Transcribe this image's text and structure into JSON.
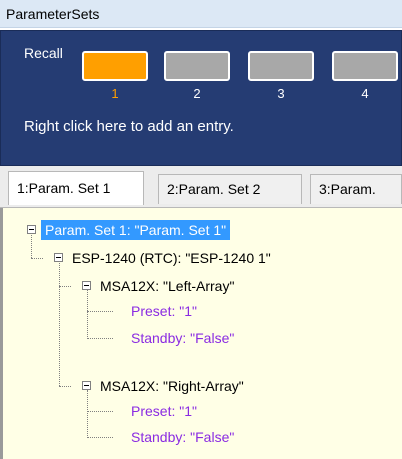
{
  "window": {
    "title": "ParameterSets"
  },
  "recall": {
    "label": "Recall",
    "slots": [
      {
        "number": "1",
        "active": true
      },
      {
        "number": "2",
        "active": false
      },
      {
        "number": "3",
        "active": false
      },
      {
        "number": "4",
        "active": false
      }
    ],
    "hint": "Right click here to add an entry.",
    "colors": {
      "panel": "#253c73",
      "active": "#ff9f00",
      "inactive": "#a8a8a8"
    }
  },
  "tabs": [
    {
      "label": "1:Param. Set 1",
      "selected": true
    },
    {
      "label": "2:Param. Set 2",
      "selected": false
    },
    {
      "label": "3:Param.",
      "selected": false
    }
  ],
  "tree": {
    "root": "Param. Set 1: \"Param. Set 1\"",
    "device": "ESP-1240 (RTC): \"ESP-1240 1\"",
    "groups": [
      {
        "label": "MSA12X: \"Left-Array\"",
        "preset": "Preset: \"1\"",
        "standby": "Standby: \"False\""
      },
      {
        "label": "MSA12X: \"Right-Array\"",
        "preset": "Preset: \"1\"",
        "standby": "Standby: \"False\""
      }
    ],
    "colors": {
      "background": "#ffffe6",
      "selection": "#3399ff",
      "leaf": "#8a2be2"
    }
  }
}
